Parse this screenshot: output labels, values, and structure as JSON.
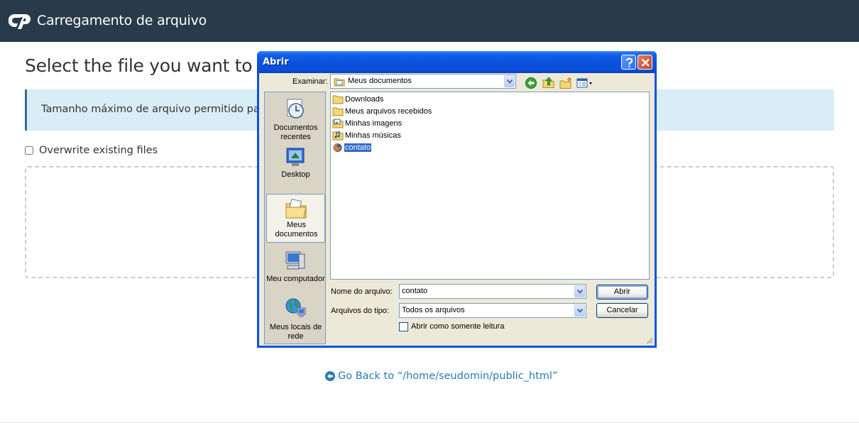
{
  "page": {
    "header_title": "Carregamento de arquivo",
    "heading": "Select the file you want to upl",
    "info_text": "Tamanho máximo de arquivo permitido para",
    "overwrite_label": "Overwrite existing files",
    "go_back_label": "Go Back to “/home/seudomin/public_html”"
  },
  "dialog": {
    "title": "Abrir",
    "look_in_label": "Examinar:",
    "look_in_value": "Meus documentos",
    "places": [
      {
        "label_line1": "Documentos",
        "label_line2": "recentes"
      },
      {
        "label_line1": "Desktop",
        "label_line2": ""
      },
      {
        "label_line1": "Meus",
        "label_line2": "documentos"
      },
      {
        "label_line1": "Meu computador",
        "label_line2": ""
      },
      {
        "label_line1": "Meus locais de",
        "label_line2": "rede"
      }
    ],
    "files": [
      {
        "name": "Downloads",
        "icon": "folder-icon"
      },
      {
        "name": "Meus arquivos recebidos",
        "icon": "folder-icon"
      },
      {
        "name": "Minhas imagens",
        "icon": "pictures-folder-icon"
      },
      {
        "name": "Minhas músicas",
        "icon": "music-folder-icon"
      },
      {
        "name": "contato",
        "icon": "firefox-file-icon"
      }
    ],
    "filename_label": "Nome do arquivo:",
    "filename_value": "contato",
    "filetype_label": "Arquivos do tipo:",
    "filetype_value": "Todos os arquivos",
    "readonly_label": "Abrir como somente leitura",
    "open_button": "Abrir",
    "cancel_button": "Cancelar"
  },
  "colors": {
    "header_bg": "#293a4a",
    "info_bg": "#d9edf7",
    "link": "#2a7ab0",
    "xp_title_blue": "#0a52df",
    "xp_face": "#ece9d8",
    "selection": "#316ac5"
  }
}
